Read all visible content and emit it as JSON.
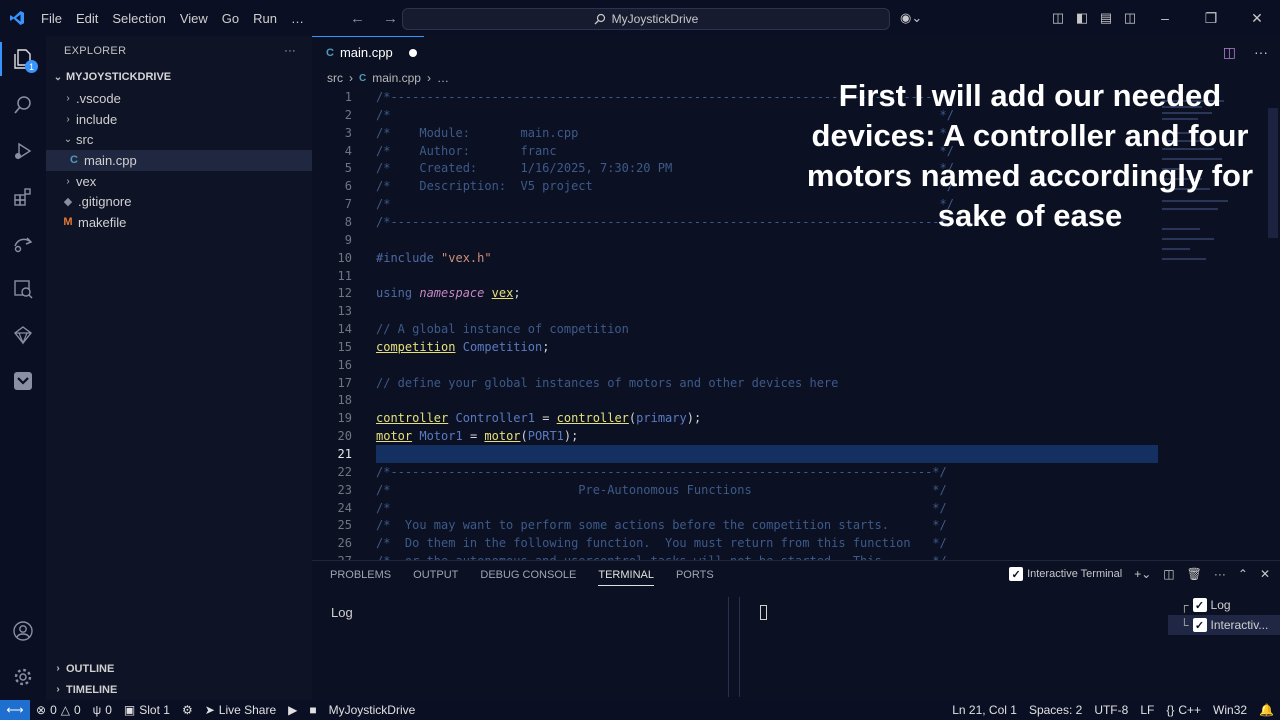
{
  "titlebar": {
    "menu": [
      "File",
      "Edit",
      "Selection",
      "View",
      "Go",
      "Run",
      "…"
    ],
    "search_text": "MyJoystickDrive",
    "icons": [
      "vscode-logo-icon",
      "back-arrow-icon",
      "forward-arrow-icon",
      "copilot-icon",
      "layout-icon",
      "minimize-icon",
      "maximize-icon",
      "close-icon"
    ]
  },
  "activity": {
    "explorer_badge": "1",
    "icons": [
      "explorer-icon",
      "search-icon",
      "run-debug-icon",
      "extensions-icon",
      "remote-explorer-icon",
      "testing-icon",
      "vex-icon",
      "checklist-icon",
      "account-icon",
      "manage-gear-icon"
    ]
  },
  "sidebar": {
    "title": "EXPLORER",
    "more": "···",
    "root": "MYJOYSTICKDRIVE",
    "items": [
      {
        "label": ".vscode",
        "kind": "folder",
        "chev": "›"
      },
      {
        "label": "include",
        "kind": "folder",
        "chev": "›"
      },
      {
        "label": "src",
        "kind": "folder-open",
        "chev": "⌄"
      },
      {
        "label": "main.cpp",
        "kind": "cpp",
        "chev": ""
      },
      {
        "label": "vex",
        "kind": "folder",
        "chev": "›"
      },
      {
        "label": ".gitignore",
        "kind": "git",
        "chev": ""
      },
      {
        "label": "makefile",
        "kind": "make",
        "chev": ""
      }
    ],
    "outline": "OUTLINE",
    "timeline": "TIMELINE"
  },
  "editor": {
    "tab": "main.cpp",
    "breadcrumb": [
      "src",
      "main.cpp",
      "…"
    ],
    "lines": [
      {
        "n": "1",
        "html": "<span class='c'>/*----------------------------------------------------------------------------*/</span>"
      },
      {
        "n": "2",
        "html": "<span class='c'>/*                                                                            */</span>"
      },
      {
        "n": "3",
        "html": "<span class='c'>/*    Module:       main.cpp                                                  */</span>"
      },
      {
        "n": "4",
        "html": "<span class='c'>/*    Author:       franc                                                     */</span>"
      },
      {
        "n": "5",
        "html": "<span class='c'>/*    Created:      1/16/2025, 7:30:20 PM                                     */</span>"
      },
      {
        "n": "6",
        "html": "<span class='c'>/*    Description:  V5 project                                                */</span>"
      },
      {
        "n": "7",
        "html": "<span class='c'>/*                                                                            */</span>"
      },
      {
        "n": "8",
        "html": "<span class='c'>/*----------------------------------------------------------------------------*/</span>"
      },
      {
        "n": "9",
        "html": ""
      },
      {
        "n": "10",
        "html": "<span class='pp'>#include</span> <span class='str'>\"vex.h\"</span>"
      },
      {
        "n": "11",
        "html": ""
      },
      {
        "n": "12",
        "html": "<span class='kw'>using</span> <span class='ns'>namespace</span> <span class='ty'>vex</span>;"
      },
      {
        "n": "13",
        "html": ""
      },
      {
        "n": "14",
        "html": "<span class='c'>// A global instance of competition</span>"
      },
      {
        "n": "15",
        "html": "<span class='ty'>competition</span> <span class='var'>Competition</span>;"
      },
      {
        "n": "16",
        "html": ""
      },
      {
        "n": "17",
        "html": "<span class='c'>// define your global instances of motors and other devices here</span>"
      },
      {
        "n": "18",
        "html": ""
      },
      {
        "n": "19",
        "html": "<span class='ty'>controller</span> <span class='var'>Controller1</span> = <span class='ty'>controller</span>(<span class='var'>primary</span>);"
      },
      {
        "n": "20",
        "html": "<span class='ty'>motor</span> <span class='var'>Motor1</span> = <span class='ty'>motor</span>(<span class='var'>PORT1</span>);"
      },
      {
        "n": "21",
        "html": ""
      },
      {
        "n": "22",
        "html": "<span class='c'>/*---------------------------------------------------------------------------*/</span>"
      },
      {
        "n": "23",
        "html": "<span class='c'>/*                          Pre-Autonomous Functions                         */</span>"
      },
      {
        "n": "24",
        "html": "<span class='c'>/*                                                                           */</span>"
      },
      {
        "n": "25",
        "html": "<span class='c'>/*  You may want to perform some actions before the competition starts.      */</span>"
      },
      {
        "n": "26",
        "html": "<span class='c'>/*  Do them in the following function.  You must return from this function   */</span>"
      },
      {
        "n": "27",
        "html": "<span class='c'>/*  or the autonomous and usercontrol tasks will not be started.  This       */</span>"
      }
    ],
    "current_line": "21"
  },
  "caption": [
    "First I will add our needed",
    "devices: A controller and four",
    "motors named accordingly for",
    "sake of ease"
  ],
  "panel": {
    "tabs": [
      "PROBLEMS",
      "OUTPUT",
      "DEBUG CONSOLE",
      "TERMINAL",
      "PORTS"
    ],
    "active_tab": "TERMINAL",
    "terminal_label": "Interactive Terminal",
    "log_text": "Log",
    "terminals": [
      "Log",
      "Interactiv..."
    ]
  },
  "status": {
    "errors": "0",
    "warnings": "0",
    "ports": "0",
    "slot": "Slot 1",
    "live_share": "Live Share",
    "project": "MyJoystickDrive",
    "position": "Ln 21, Col 1",
    "spaces": "Spaces: 2",
    "encoding": "UTF-8",
    "eol": "LF",
    "language": "C++",
    "platform": "Win32"
  },
  "colors": {
    "background": "#0b1023",
    "accent": "#3794ff",
    "type": "#e5e07a",
    "comment": "#3d5a8a"
  }
}
